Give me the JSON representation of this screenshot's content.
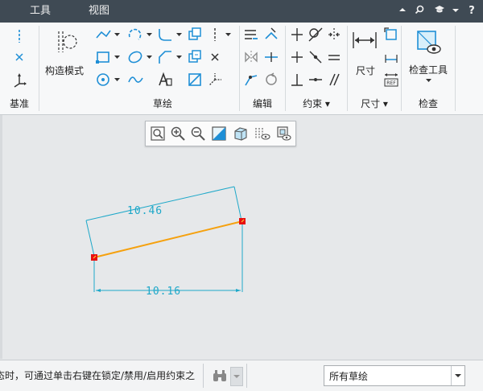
{
  "menu": {
    "tabs": [
      "工具",
      "视图"
    ],
    "quick_access": [
      "collapse-ribbon-icon",
      "search-icon",
      "graduation-cap-icon",
      "more-menu-icon",
      "help-icon"
    ]
  },
  "ribbon": {
    "groups": {
      "datum": "基准",
      "sketch": "草绘",
      "edit": "编辑",
      "constraint": "约束 ▾",
      "dimension": "尺寸 ▾",
      "inspect": "检查"
    },
    "labels": {
      "construction_mode": "构造模式",
      "dimension": "尺寸",
      "inspect_tools": "检查工具"
    },
    "accent_color": "#1f8fd6"
  },
  "canvas": {
    "dimensions": [
      "10.46",
      "10.16"
    ],
    "line_color": "#f5a10f",
    "dimension_color": "#1ea8c9",
    "endpoint_color": "#e81010"
  },
  "status": {
    "message": "态时，可通过单击右键在锁定/禁用/启用约束之",
    "filter_value": "所有草绘"
  }
}
